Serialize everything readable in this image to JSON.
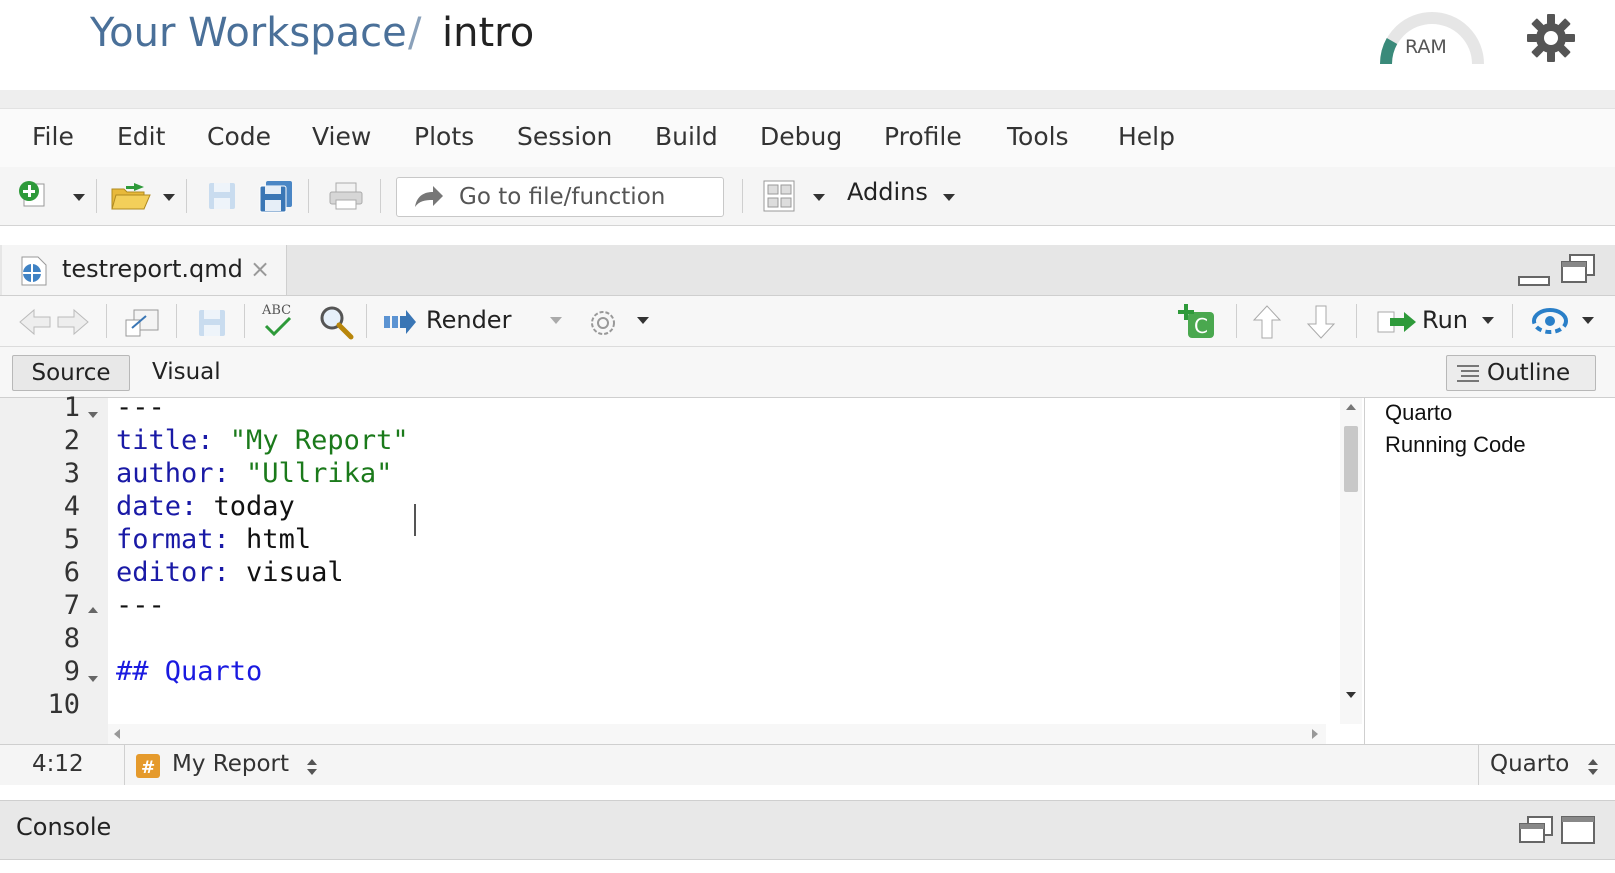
{
  "header": {
    "workspace": "Your Workspace",
    "separator": "/",
    "project": "intro",
    "ram_label": "RAM"
  },
  "menu": [
    "File",
    "Edit",
    "Code",
    "View",
    "Plots",
    "Session",
    "Build",
    "Debug",
    "Profile",
    "Tools",
    "Help"
  ],
  "toolbar": {
    "goto_placeholder": "Go to file/function",
    "addins_label": "Addins"
  },
  "tab": {
    "filename": "testreport.qmd",
    "close": "×"
  },
  "editor_toolbar": {
    "render_label": "Render",
    "run_label": "Run"
  },
  "mode": {
    "source": "Source",
    "visual": "Visual",
    "outline": "Outline"
  },
  "editor": {
    "line_numbers": [
      "1",
      "2",
      "3",
      "4",
      "5",
      "6",
      "7",
      "8",
      "9",
      "10"
    ],
    "lines": [
      [
        {
          "t": "---",
          "c": "p"
        }
      ],
      [
        {
          "t": "title:",
          "c": "k"
        },
        {
          "t": " \"My Report\"",
          "c": "s"
        }
      ],
      [
        {
          "t": "author:",
          "c": "k"
        },
        {
          "t": " \"Ullrika\"",
          "c": "s"
        }
      ],
      [
        {
          "t": "date:",
          "c": "k"
        },
        {
          "t": " today",
          "c": "p"
        }
      ],
      [
        {
          "t": "format:",
          "c": "k"
        },
        {
          "t": " html",
          "c": "p"
        }
      ],
      [
        {
          "t": "editor:",
          "c": "k"
        },
        {
          "t": " visual",
          "c": "p"
        }
      ],
      [
        {
          "t": "---",
          "c": "p"
        }
      ],
      [],
      [
        {
          "t": "## Quarto",
          "c": "h"
        }
      ],
      []
    ]
  },
  "outline_items": [
    "Quarto",
    "Running Code"
  ],
  "status": {
    "position": "4:12",
    "section": "My Report",
    "filetype": "Quarto"
  },
  "console": {
    "label": "Console"
  },
  "colors": {
    "workspace_link": "#4a7099",
    "yaml_key": "#1a1aa6",
    "string": "#1b7a1b",
    "heading": "#1a1ae0",
    "accent_green": "#2e9a3a",
    "accent_blue": "#2a7fc8"
  }
}
